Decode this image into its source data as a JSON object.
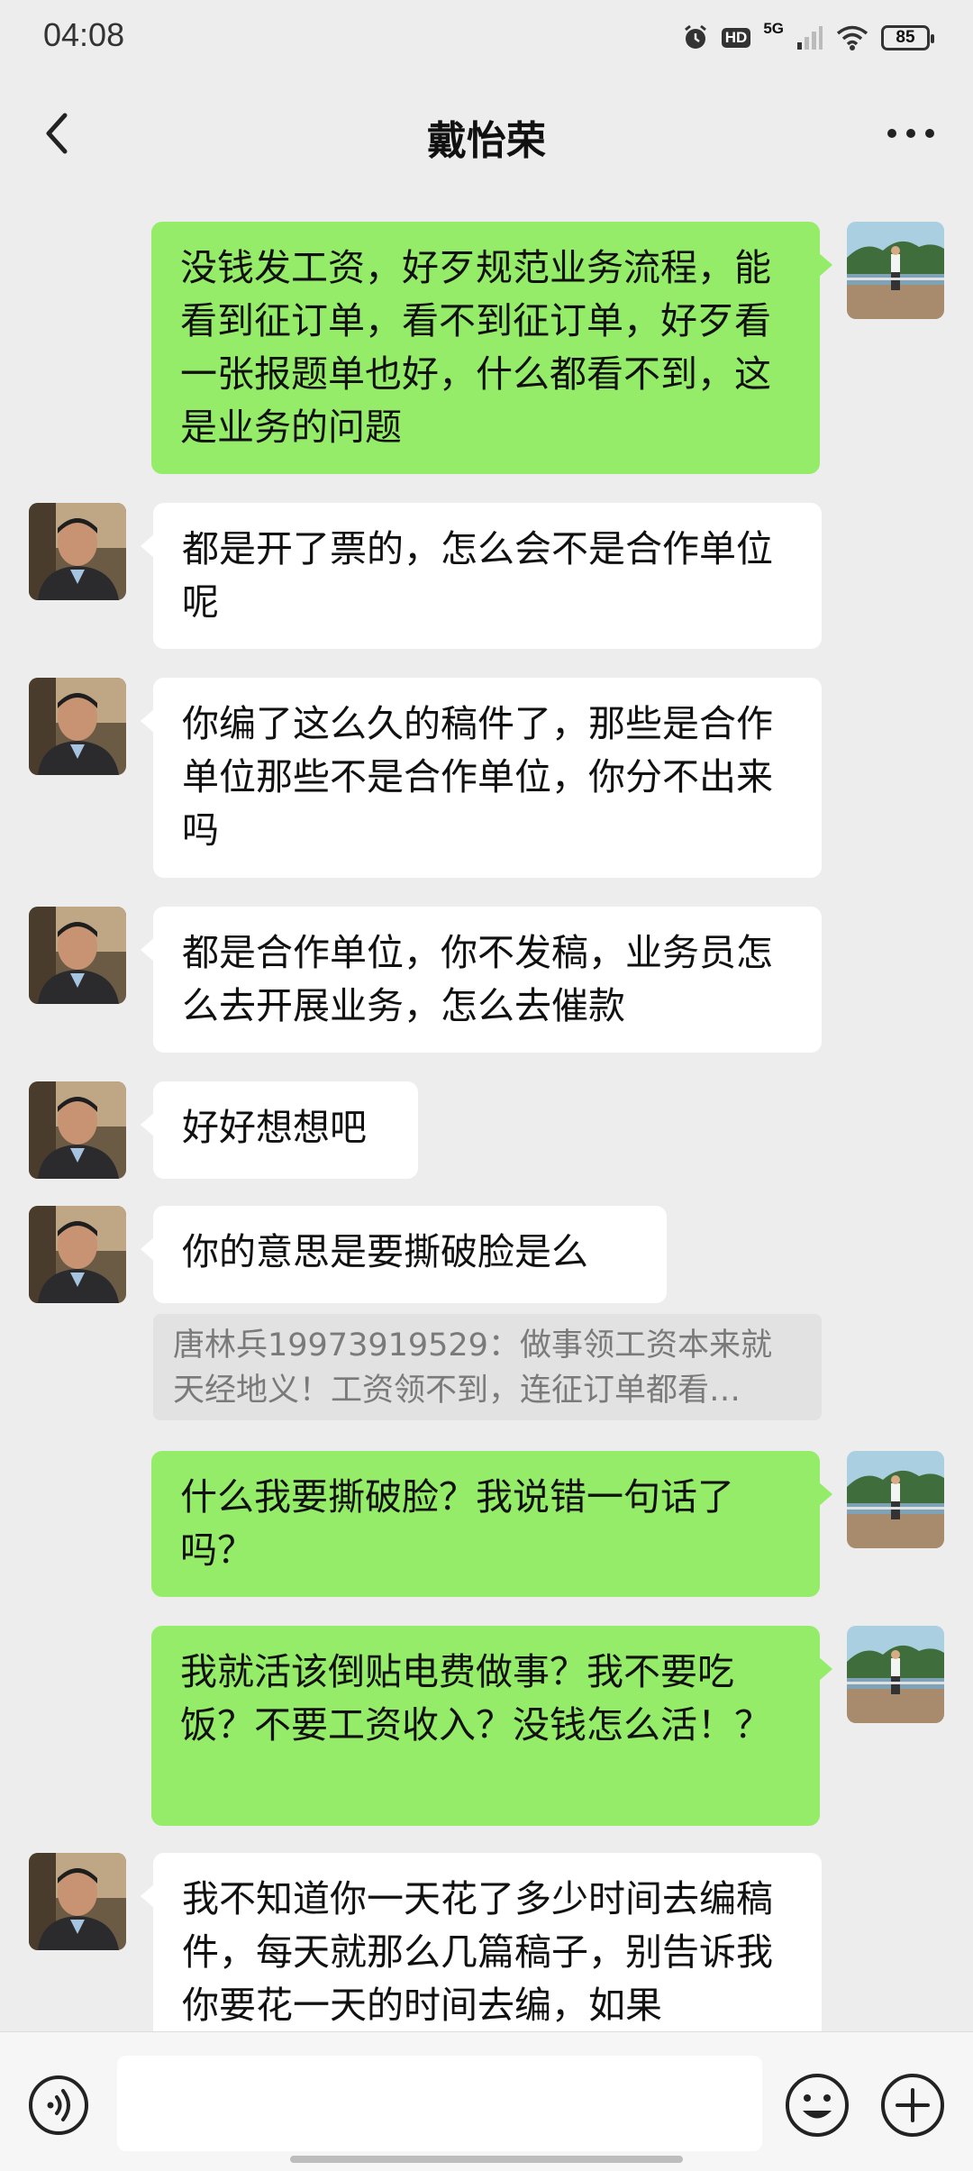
{
  "status_bar": {
    "time": "04:08",
    "hd": "HD",
    "network": "5G",
    "battery": "85"
  },
  "header": {
    "title": "戴怡荣",
    "back_icon": "chevron-left-icon",
    "more_icon": "more-dots-icon"
  },
  "messages": [
    {
      "sender": "self",
      "text": "没钱发工资，好歹规范业务流程，能看到征订单，看不到征订单，好歹看一张报题单也好，什么都看不到，这是业务的问题"
    },
    {
      "sender": "other",
      "text": "都是开了票的，怎么会不是合作单位呢"
    },
    {
      "sender": "other",
      "text": "你编了这么久的稿件了，那些是合作单位那些不是合作单位，你分不出来吗"
    },
    {
      "sender": "other",
      "text": "都是合作单位，你不发稿，业务员怎么去开展业务，怎么去催款"
    },
    {
      "sender": "other",
      "text": "好好想想吧"
    },
    {
      "sender": "other",
      "text": "你的意思是要撕破脸是么"
    },
    {
      "sender": "quote",
      "line1": "唐林兵19973919529：做事领工资本来就",
      "line2": "天经地义！工资领不到，连征订单都看…"
    },
    {
      "sender": "self",
      "text": "什么我要撕破脸？我说错一句话了吗？"
    },
    {
      "sender": "self",
      "text": "我就活该倒贴电费做事？我不要吃饭？不要工资收入？没钱怎么活！？"
    },
    {
      "sender": "other",
      "text": "我不知道你一天花了多少时间去编稿件，每天就那么几篇稿子，别告诉我你要花一天的时间去编，如果"
    }
  ],
  "input_bar": {
    "voice_icon": "voice-icon",
    "emoji_icon": "emoji-icon",
    "plus_icon": "plus-icon"
  },
  "colors": {
    "self_bubble": "#95ec69",
    "other_bubble": "#ffffff",
    "background": "#ededed"
  }
}
